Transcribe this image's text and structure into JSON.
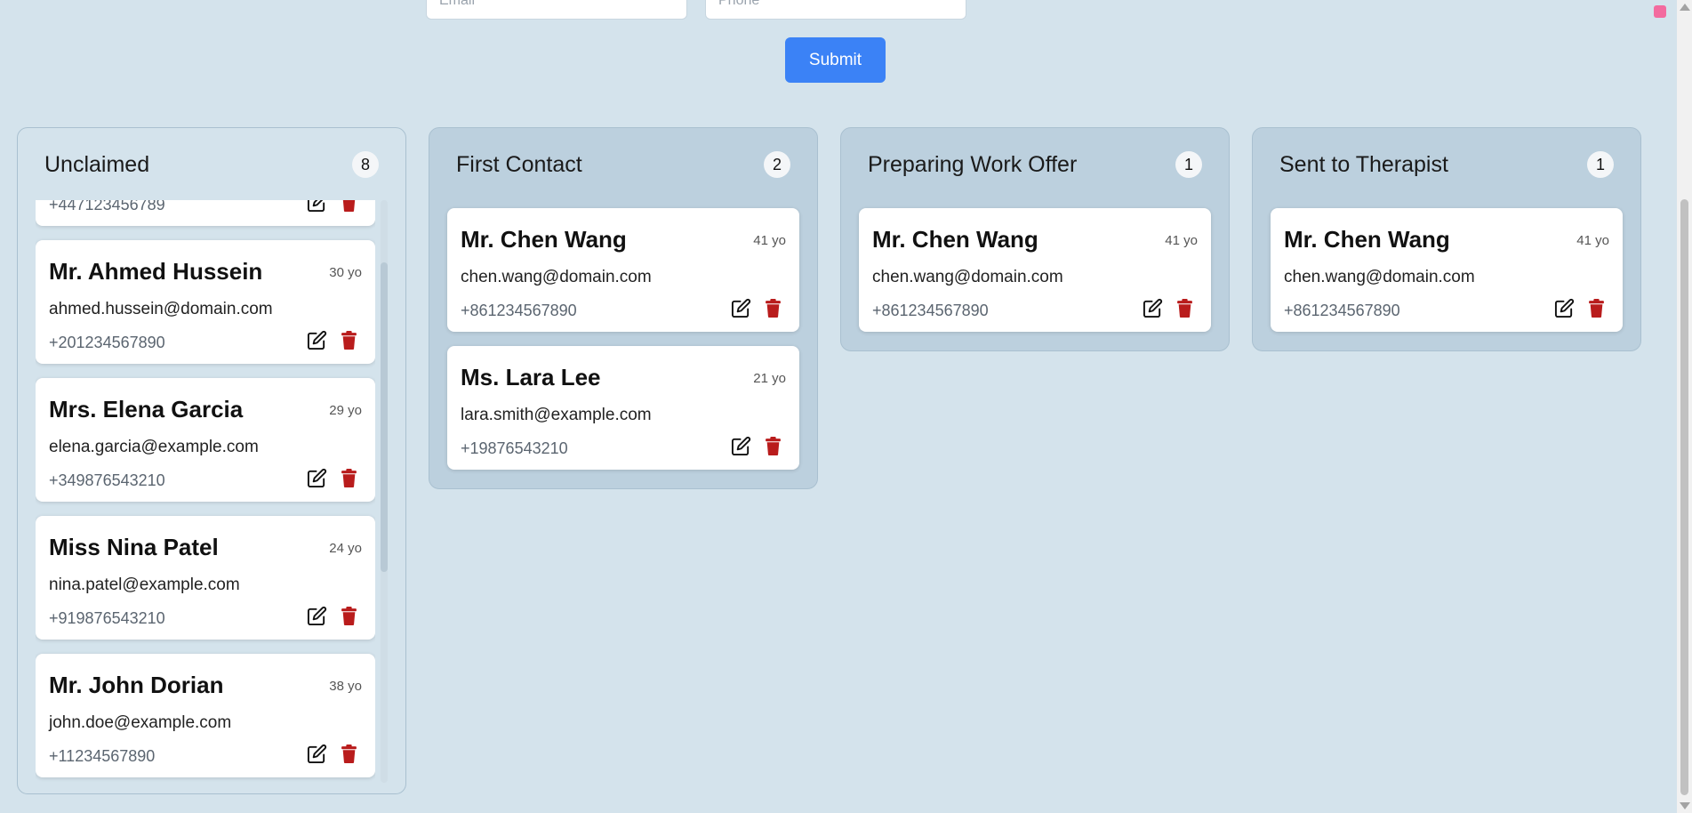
{
  "form": {
    "email_placeholder": "Email",
    "phone_placeholder": "Phone",
    "submit_label": "Submit"
  },
  "colors": {
    "accent": "#3b82f6",
    "delete": "#b91c1c",
    "background": "#d4e3ec",
    "column": "#bcd0de"
  },
  "icons": {
    "edit": "edit-icon",
    "delete": "trash-icon"
  },
  "columns": [
    {
      "title": "Unclaimed",
      "count": "8",
      "partial_phone": "+447123456789",
      "cards": [
        {
          "name": "Mr. Ahmed Hussein",
          "age": "30 yo",
          "email": "ahmed.hussein@domain.com",
          "phone": "+201234567890"
        },
        {
          "name": "Mrs. Elena Garcia",
          "age": "29 yo",
          "email": "elena.garcia@example.com",
          "phone": "+349876543210"
        },
        {
          "name": "Miss Nina Patel",
          "age": "24 yo",
          "email": "nina.patel@example.com",
          "phone": "+919876543210"
        },
        {
          "name": "Mr. John Dorian",
          "age": "38 yo",
          "email": "john.doe@example.com",
          "phone": "+11234567890"
        }
      ]
    },
    {
      "title": "First Contact",
      "count": "2",
      "cards": [
        {
          "name": "Mr. Chen Wang",
          "age": "41 yo",
          "email": "chen.wang@domain.com",
          "phone": "+861234567890"
        },
        {
          "name": "Ms. Lara Lee",
          "age": "21 yo",
          "email": "lara.smith@example.com",
          "phone": "+19876543210"
        }
      ]
    },
    {
      "title": "Preparing Work Offer",
      "count": "1",
      "cards": [
        {
          "name": "Mr. Chen Wang",
          "age": "41 yo",
          "email": "chen.wang@domain.com",
          "phone": "+861234567890"
        }
      ]
    },
    {
      "title": "Sent to Therapist",
      "count": "1",
      "cards": [
        {
          "name": "Mr. Chen Wang",
          "age": "41 yo",
          "email": "chen.wang@domain.com",
          "phone": "+861234567890"
        }
      ]
    }
  ]
}
